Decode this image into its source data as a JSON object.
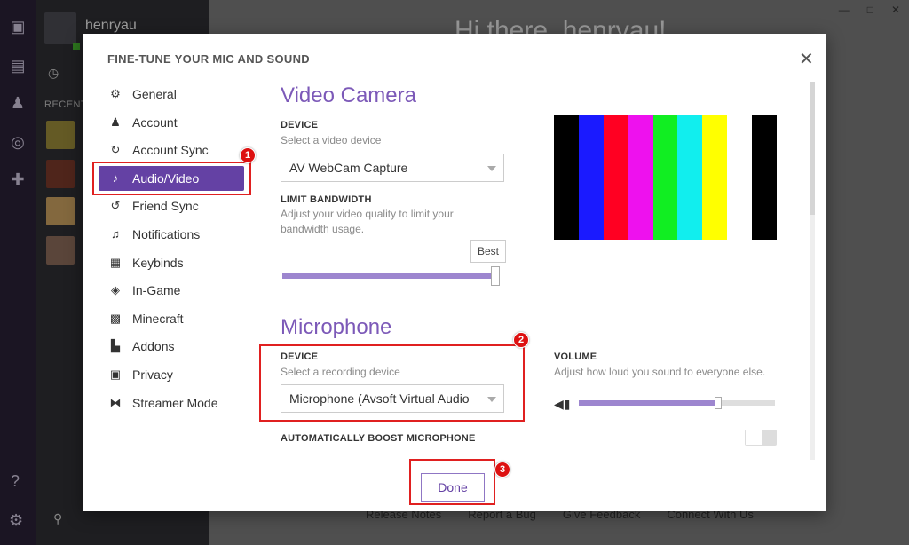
{
  "background": {
    "user_name": "henryau",
    "recent_label": "RECENT",
    "greeting": "Hi there, henryau!",
    "footer_links": [
      "Release Notes",
      "Report a Bug",
      "Give Feedback",
      "Connect With Us"
    ]
  },
  "modal": {
    "title": "FINE-TUNE YOUR MIC AND SOUND",
    "nav": [
      {
        "label": "General",
        "icon": "gear-icon"
      },
      {
        "label": "Account",
        "icon": "user-icon"
      },
      {
        "label": "Account Sync",
        "icon": "sync-icon"
      },
      {
        "label": "Audio/Video",
        "icon": "microphone-icon",
        "active": true
      },
      {
        "label": "Friend Sync",
        "icon": "friend-sync-icon"
      },
      {
        "label": "Notifications",
        "icon": "bell-icon"
      },
      {
        "label": "Keybinds",
        "icon": "keyboard-icon"
      },
      {
        "label": "In-Game",
        "icon": "layers-icon"
      },
      {
        "label": "Minecraft",
        "icon": "minecraft-icon"
      },
      {
        "label": "Addons",
        "icon": "addons-icon"
      },
      {
        "label": "Privacy",
        "icon": "lock-icon"
      },
      {
        "label": "Streamer Mode",
        "icon": "streamer-icon"
      }
    ],
    "video": {
      "title": "Video Camera",
      "device_label": "DEVICE",
      "device_sub": "Select a video device",
      "device_value": "AV WebCam Capture",
      "bandwidth_label": "LIMIT BANDWIDTH",
      "bandwidth_sub": "Adjust your video quality to limit your bandwidth usage.",
      "bandwidth_tooltip": "Best",
      "bandwidth_level": 1.0,
      "preview_colors": [
        "#000000",
        "#1a1aff",
        "#ff0022",
        "#ee11ee",
        "#11ee22",
        "#11eeee",
        "#ffff00",
        "#ffffff",
        "#000000"
      ]
    },
    "mic": {
      "title": "Microphone",
      "device_label": "DEVICE",
      "device_sub": "Select a recording device",
      "device_value": "Microphone (Avsoft Virtual Audio",
      "volume_label": "VOLUME",
      "volume_sub": "Adjust how loud you sound to everyone else.",
      "volume_level": 0.71,
      "boost_label": "AUTOMATICALLY BOOST MICROPHONE",
      "boost_on": false
    },
    "done_label": "Done"
  },
  "annotations": [
    "1",
    "2",
    "3"
  ],
  "colors": {
    "accent": "#6441a4",
    "highlight": "#e02020"
  }
}
